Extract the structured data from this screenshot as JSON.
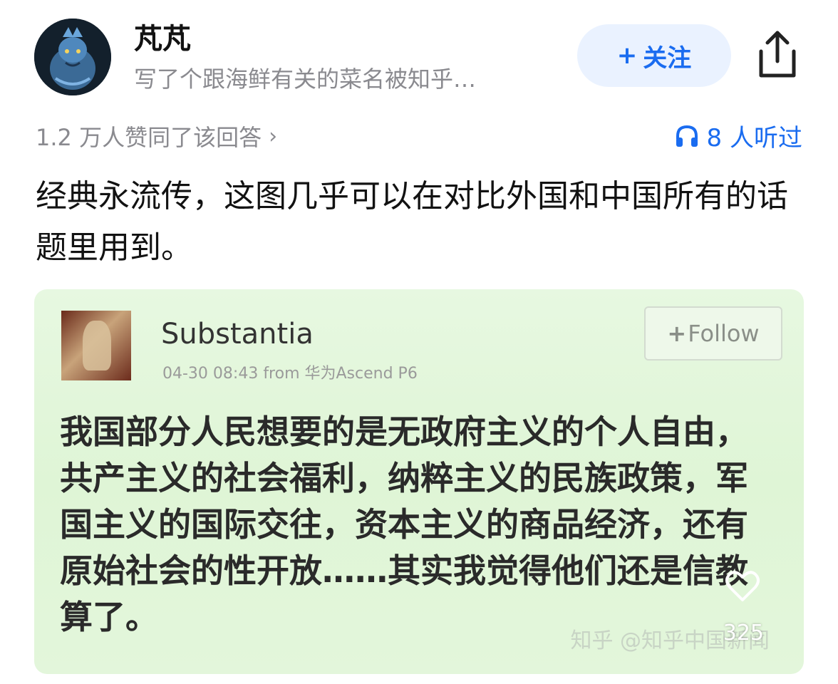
{
  "author": {
    "name": "芃芃",
    "bio": "写了个跟海鲜有关的菜名被知乎…",
    "avatar_icon": "dragon-avatar"
  },
  "follow_button": {
    "plus": "+",
    "label": "关注"
  },
  "share_icon": "share-icon",
  "meta": {
    "agree_text": "1.2 万人赞同了该回答",
    "chevron": "›",
    "listen_text": "8 人听过"
  },
  "answer": {
    "text": "经典永流传，这图几乎可以在对比外国和中国所有的话题里用到。"
  },
  "image": {
    "username": "Substantia",
    "meta": "04-30 08:43  from  华为Ascend P6",
    "follow_plus": "+",
    "follow_label": "Follow",
    "text": "我国部分人民想要的是无政府主义的个人自由，共产主义的社会福利，纳粹主义的民族政策，军国主义的国际交往，资本主义的商品经济，还有原始社会的性开放……其实我觉得他们还是信教算了。",
    "watermark": "知乎 @知乎中国新闻",
    "like_count": "325"
  },
  "colors": {
    "accent": "#1a6cf0",
    "follow_bg": "#eaf2ff",
    "muted": "#8a8a8f",
    "image_bg": "#e2f6da"
  }
}
